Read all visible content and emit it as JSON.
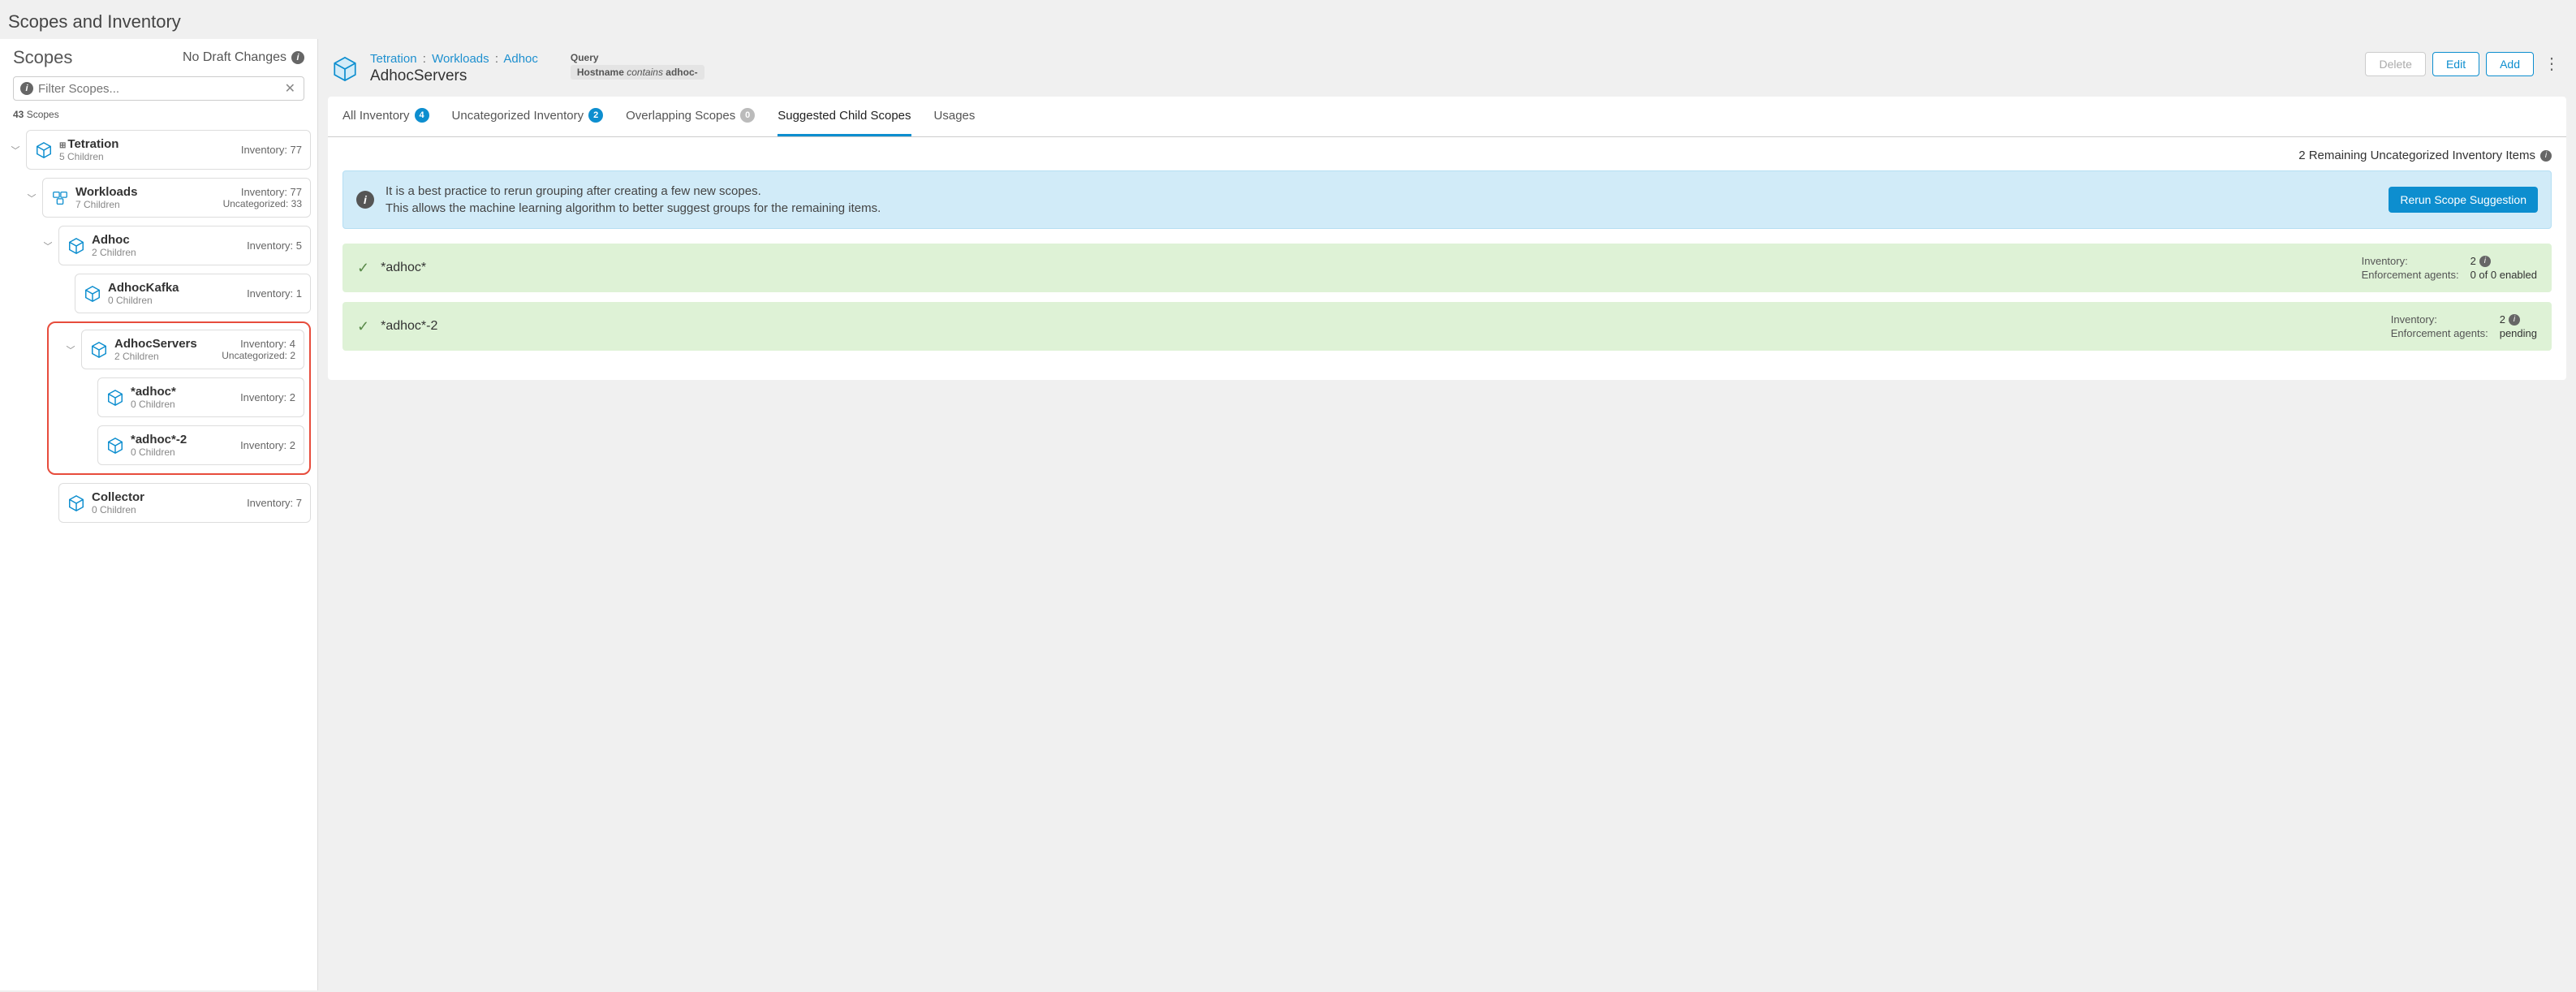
{
  "page": {
    "title": "Scopes and Inventory"
  },
  "left": {
    "title": "Scopes",
    "draft_status": "No Draft Changes",
    "filter_placeholder": "Filter Scopes...",
    "scope_count_num": "43",
    "scope_count_label": "Scopes"
  },
  "tree": {
    "tetration": {
      "name": "Tetration",
      "children": "5 Children",
      "inv": "Inventory: 77"
    },
    "workloads": {
      "name": "Workloads",
      "children": "7 Children",
      "inv": "Inventory: 77",
      "uncat": "Uncategorized: 33"
    },
    "adhoc": {
      "name": "Adhoc",
      "children": "2 Children",
      "inv": "Inventory: 5"
    },
    "adhockafka": {
      "name": "AdhocKafka",
      "children": "0 Children",
      "inv": "Inventory: 1"
    },
    "adhocservers": {
      "name": "AdhocServers",
      "children": "2 Children",
      "inv": "Inventory: 4",
      "uncat": "Uncategorized: 2"
    },
    "adhoc1": {
      "name": "*adhoc*",
      "children": "0 Children",
      "inv": "Inventory: 2"
    },
    "adhoc2": {
      "name": "*adhoc*-2",
      "children": "0 Children",
      "inv": "Inventory: 2"
    },
    "collector": {
      "name": "Collector",
      "children": "0 Children",
      "inv": "Inventory: 7"
    }
  },
  "detail": {
    "crumbs": {
      "a": "Tetration",
      "b": "Workloads",
      "c": "Adhoc",
      "sep": ":"
    },
    "name": "AdhocServers",
    "query_label": "Query",
    "query": {
      "field": "Hostname",
      "op": "contains",
      "value": "adhoc-"
    },
    "actions": {
      "delete": "Delete",
      "edit": "Edit",
      "add": "Add"
    }
  },
  "tabs": {
    "all": {
      "label": "All Inventory",
      "badge": "4"
    },
    "uncat": {
      "label": "Uncategorized Inventory",
      "badge": "2"
    },
    "overlap": {
      "label": "Overlapping Scopes",
      "badge": "0"
    },
    "suggest": {
      "label": "Suggested Child Scopes"
    },
    "usages": {
      "label": "Usages"
    }
  },
  "body": {
    "remaining": "2 Remaining Uncategorized Inventory Items",
    "notice_line1": "It is a best practice to rerun grouping after creating a few new scopes.",
    "notice_line2": "This allows the machine learning algorithm to better suggest groups for the remaining items.",
    "rerun_btn": "Rerun Scope Suggestion",
    "sugg": [
      {
        "name": "*adhoc*",
        "inv_label": "Inventory:",
        "inv_val": "2",
        "enf_label": "Enforcement agents:",
        "enf_val": "0 of 0 enabled"
      },
      {
        "name": "*adhoc*-2",
        "inv_label": "Inventory:",
        "inv_val": "2",
        "enf_label": "Enforcement agents:",
        "enf_val": "pending"
      }
    ]
  }
}
